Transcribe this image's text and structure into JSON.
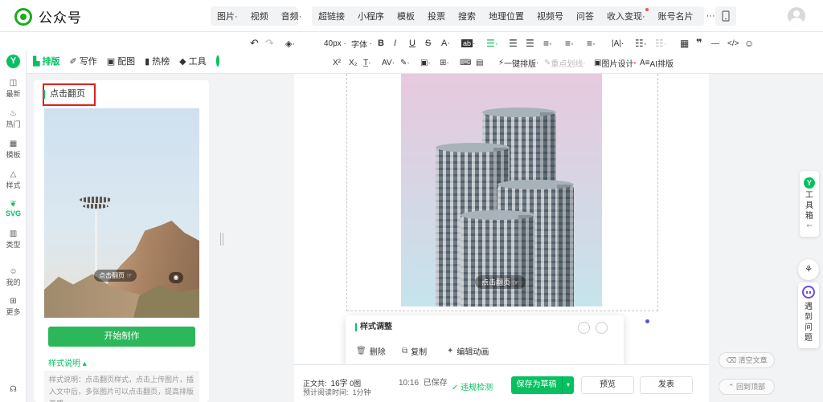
{
  "app": {
    "logo_text": "公众号"
  },
  "top_menu": {
    "group1": [
      {
        "label": "图片",
        "has_dropdown": true
      },
      {
        "label": "视频",
        "has_dropdown": false
      },
      {
        "label": "音频",
        "has_dropdown": true
      }
    ],
    "group2": [
      {
        "label": "超链接"
      },
      {
        "label": "小程序"
      },
      {
        "label": "模板"
      },
      {
        "label": "投票"
      },
      {
        "label": "搜索"
      },
      {
        "label": "地理位置"
      },
      {
        "label": "视频号"
      },
      {
        "label": "问答"
      },
      {
        "label": "收入变现",
        "badge": true
      },
      {
        "label": "账号名片"
      }
    ],
    "more": "···"
  },
  "format_toolbar": {
    "font_size": "40px",
    "font_family": "字体",
    "ai_layout": "一键排版",
    "emphasis": "重点划线",
    "image_design": "图片设计",
    "ai_format": "AI排版"
  },
  "panel_tabs": [
    {
      "label": "排版",
      "active": true
    },
    {
      "label": "写作",
      "active": false
    },
    {
      "label": "配图",
      "active": false
    },
    {
      "label": "热榜",
      "active": false
    },
    {
      "label": "工具",
      "active": false
    }
  ],
  "left_nav": [
    {
      "label": "最新",
      "icon": "chat-icon"
    },
    {
      "label": "热门",
      "icon": "fire-icon"
    },
    {
      "label": "模板",
      "icon": "grid-icon"
    },
    {
      "label": "样式",
      "icon": "triangle-icon"
    },
    {
      "label": "SVG",
      "icon": "svg-icon",
      "active": true
    },
    {
      "label": "类型",
      "icon": "book-icon"
    },
    {
      "label": "我的",
      "icon": "user-icon"
    },
    {
      "label": "更多",
      "icon": "apps-icon"
    }
  ],
  "panel": {
    "title": "点击翻页",
    "card_flip_label": "点击翻页",
    "start_button": "开始制作",
    "style_desc_label": "样式说明",
    "style_desc_text": "样式说明：点击翻页样式，点击上传图片，插入文中后，多张图片可以点击翻页，提高排版美感"
  },
  "editor": {
    "photo_flip_label": "点击翻页"
  },
  "style_popup": {
    "title": "样式调整",
    "actions": [
      {
        "label": "删除",
        "icon": "trash-icon"
      },
      {
        "label": "复制",
        "icon": "copy-icon"
      },
      {
        "label": "编辑动画",
        "icon": "sparkle-icon"
      }
    ]
  },
  "bottom_bar": {
    "word_count_label": "正文共:",
    "word_count": "16字",
    "image_count": "0图",
    "read_time_label": "预计阅读时间:",
    "read_time": "1分钟",
    "saved_time": "10:16",
    "saved_label": "已保存",
    "violation_check": "违规检测",
    "save_draft": "保存为草稿",
    "preview": "预览",
    "publish": "发表"
  },
  "right_side": {
    "toolbox_label": "工具箱",
    "meet_label": "遇到问题",
    "clear_article": "清空文章",
    "back_to_top": "回到顶部"
  },
  "colors": {
    "brand_green": "#07c160",
    "button_green": "#2bb75a",
    "highlight_red": "#e02020",
    "accent_purple": "#6b4be0"
  }
}
